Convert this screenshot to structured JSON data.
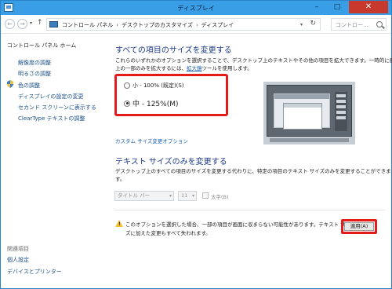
{
  "window": {
    "title": "ディスプレイ",
    "minimize_glyph": "–",
    "maximize_glyph": "□",
    "close_glyph": "✕"
  },
  "address_bar": {
    "crumbs": [
      "コントロール パネル",
      "デスクトップのカスタマイズ",
      "ディスプレイ"
    ],
    "separator": "›",
    "search_placeholder": "コントロー..."
  },
  "sidebar": {
    "home": "コントロール パネル ホーム",
    "items": [
      "解像度の調整",
      "明るさの調整",
      "色の調整",
      "ディスプレイの設定の変更",
      "セカンド スクリーンに表示する",
      "ClearType テキストの調整"
    ],
    "see_also_header": "関連項目",
    "see_also": [
      "個人設定",
      "デバイスとプリンター"
    ]
  },
  "main": {
    "heading": "すべての項目のサイズを変更する",
    "desc_line1": "これらのいずれかのオプションを選択することで、デスクトップ上のテキストやその他の項目を拡大できます。一時的に画面",
    "desc_line2_prefix": "上の一部のみを拡大するには、",
    "desc_line2_link": "拡大鏡",
    "desc_line2_suffix": "ツールを使用します。",
    "options": [
      {
        "label": "小 - 100% (既定)(S)",
        "selected": false
      },
      {
        "label": "中 - 125%(M)",
        "selected": true
      }
    ],
    "custom_link": "カスタム サイズ変更オプション"
  },
  "text_size": {
    "heading": "テキスト サイズのみを変更する",
    "desc_line1": "デスクトップ上のすべての項目のサイズを変更する代わりに、特定の項目のテキスト サイズのみを変更することができま",
    "desc_line2": "す。",
    "item_select": "タイトル バー",
    "size_select": "11",
    "bold_label": "太字(B)"
  },
  "warning": {
    "line1": "このオプションを選択した場合、一部の項目が画面に収まらない可能性があります。テキスト サイ",
    "line2": "ズに加えた変更もすべて失われます。"
  },
  "apply_label": "適用(A)",
  "colors": {
    "titlebar": "#3a9ee6",
    "heading": "#1e3a8a",
    "link": "#1a4f88",
    "highlight": "#e31b1b"
  }
}
